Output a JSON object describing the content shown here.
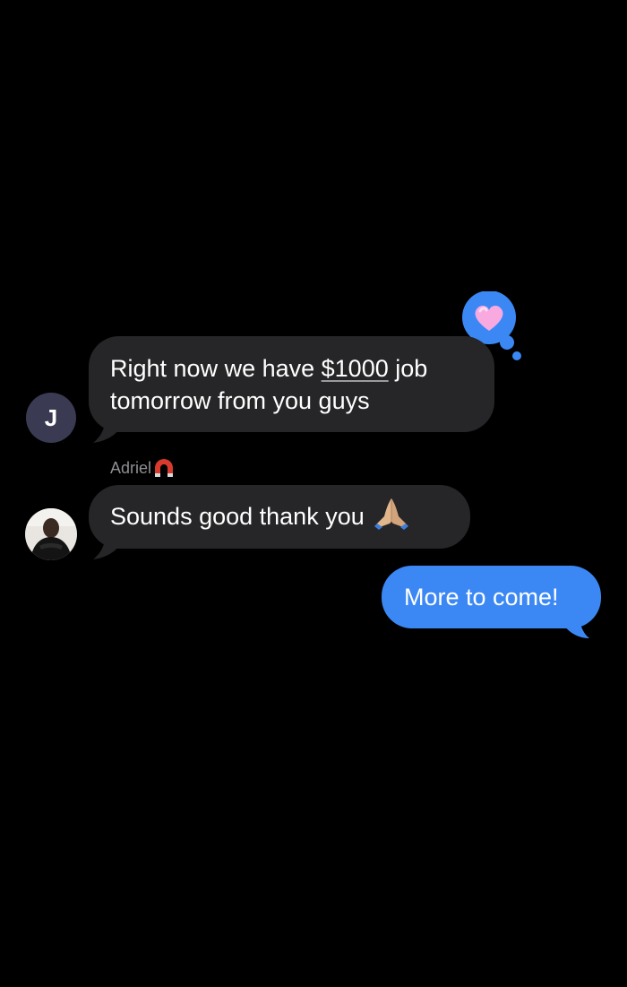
{
  "messages": [
    {
      "direction": "incoming",
      "avatar_initial": "J",
      "text_before": "Right now we have ",
      "text_link": "$1000",
      "text_after": " job tomorrow from you guys",
      "reaction_icon": "pink-heart-icon"
    },
    {
      "direction": "incoming",
      "sender": "Adriel",
      "sender_icon": "magnet-icon",
      "text": "Sounds good thank you",
      "emoji_icon": "folded-hands-icon"
    },
    {
      "direction": "outgoing",
      "text": "More to come!"
    }
  ],
  "colors": {
    "background": "#000000",
    "incoming_bubble": "#262628",
    "outgoing_bubble": "#3b88f4",
    "secondary_text": "#8e8e93"
  }
}
